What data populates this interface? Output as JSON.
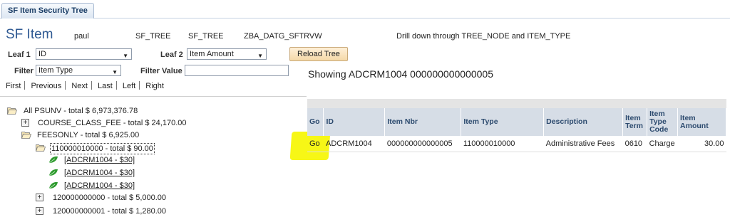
{
  "tab": {
    "label": "SF Item Security Tree"
  },
  "header": {
    "title": "SF Item",
    "user": "paul",
    "tree_name": "SF_TREE",
    "tree_name2": "SF_TREE",
    "record": "ZBA_DATG_SFTRVW",
    "note": "Drill down through TREE_NODE and ITEM_TYPE"
  },
  "form": {
    "leaf1_label": "Leaf 1",
    "leaf1_value": "ID",
    "leaf2_label": "Leaf 2",
    "leaf2_value": "Item Amount",
    "reload_button": "Reload Tree",
    "filter_label": "Filter",
    "filter_value": "Item Type",
    "filter_value_label": "Filter Value",
    "filter_value_input": ""
  },
  "nav": {
    "first": "First",
    "previous": "Previous",
    "next": "Next",
    "last": "Last",
    "left": "Left",
    "right": "Right"
  },
  "tree": {
    "root": "All PSUNV - total $ 6,973,376.78",
    "course_class_fee": "COURSE_CLASS_FEE - total $ 24,170.00",
    "feesonly": "FEESONLY - total $ 6,925.00",
    "node_110": "110000010000 - total $ 90.00",
    "leaf_1": "[ADCRM1004 - $30]",
    "leaf_2": "[ADCRM1004 - $30]",
    "leaf_3": "[ADCRM1004 - $30]",
    "node_120_0": "120000000000 - total $ 5,000.00",
    "node_120_1": "120000000001 - total $ 1,280.00"
  },
  "detail": {
    "showing": "Showing ADCRM1004 000000000000005",
    "columns": {
      "go": "Go",
      "id": "ID",
      "item_nbr": "Item Nbr",
      "item_type": "Item Type",
      "description": "Description",
      "item_term": "Item Term",
      "item_type_code": "Item Type Code",
      "item_amount": "Item Amount"
    },
    "rows": [
      {
        "go": "Go",
        "id": "ADCRM1004",
        "item_nbr": "000000000000005",
        "item_type": "110000010000",
        "description": "Administrative Fees",
        "item_term": "0610",
        "item_type_code": "Charge",
        "item_amount": "30.00"
      }
    ]
  },
  "colors": {
    "title_blue": "#2f5a93",
    "header_bg": "#d6dde6",
    "highlight": "#f7f70a",
    "leaf_green": "#2e9a2e"
  }
}
